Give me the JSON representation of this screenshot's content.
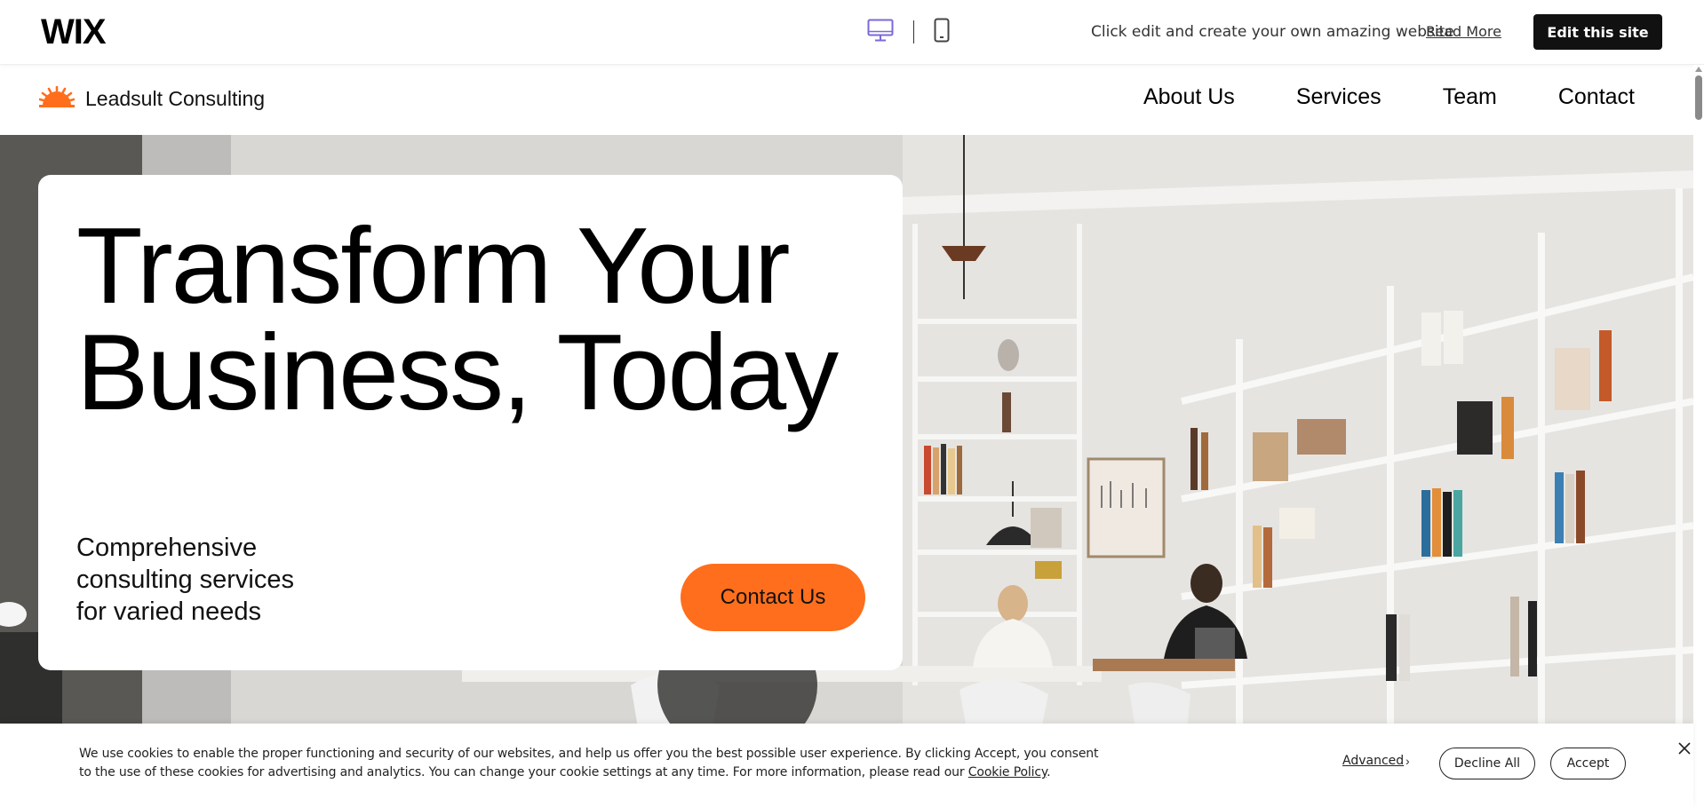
{
  "wix_bar": {
    "logo": "WIX",
    "desktop_icon": "desktop-monitor-icon",
    "mobile_icon": "mobile-phone-icon",
    "promo_text": "Click edit and create your own amazing website",
    "read_more": "Read More",
    "edit_button": "Edit this site",
    "accent_color": "#7b68d8"
  },
  "header": {
    "brand_name": "Leadsult Consulting",
    "brand_icon": "sunrise-logo-icon",
    "brand_color": "#ff6e1c",
    "nav": [
      "About Us",
      "Services",
      "Team",
      "Contact"
    ]
  },
  "hero": {
    "headline_line1": "Transform Your",
    "headline_line2": "Business, Today",
    "subtext_line1": "Comprehensive",
    "subtext_line2": "consulting services",
    "subtext_line3": "for varied needs",
    "cta_label": "Contact Us",
    "cta_color": "#ff6e1c"
  },
  "cookie_banner": {
    "text": "We use cookies to enable the proper functioning and security of our websites, and help us offer you the best possible user experience. By clicking Accept, you consent to the use of these cookies for advertising and analytics. You can change your cookie settings at any time. For more information, please read our",
    "policy_link": "Cookie Policy",
    "period": ".",
    "advanced": "Advanced",
    "decline": "Decline All",
    "accept": "Accept",
    "close_icon": "close-icon"
  }
}
